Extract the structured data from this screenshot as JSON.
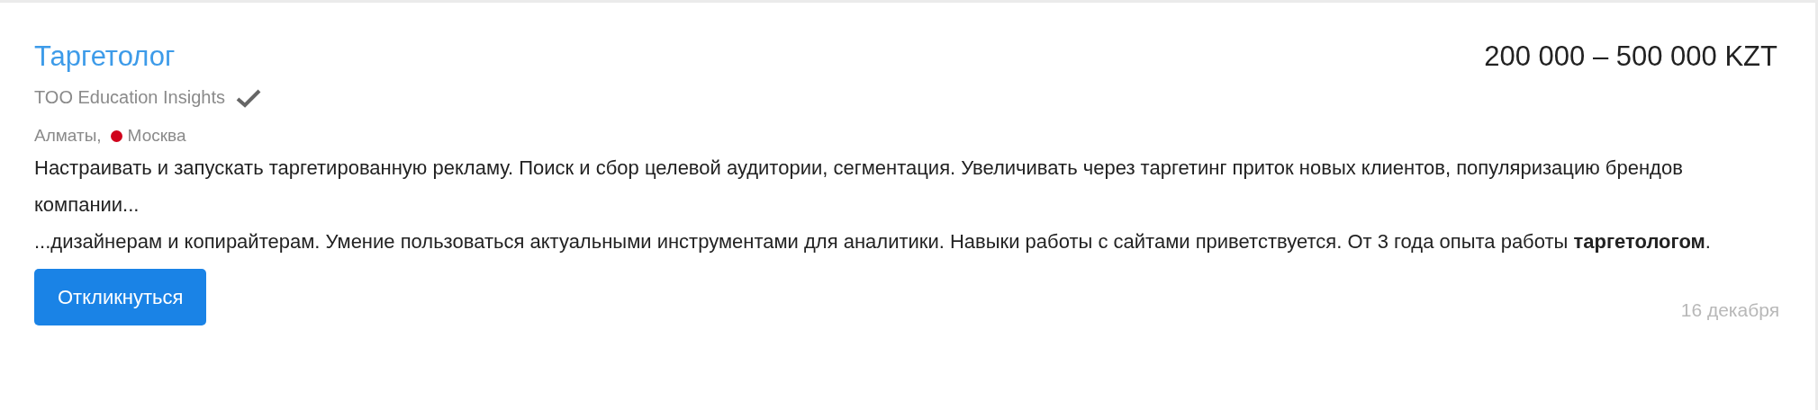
{
  "vacancy": {
    "title": "Таргетолог",
    "salary": "200 000 – 500 000 KZT",
    "company": {
      "name": "TOO Education Insights",
      "verified": true
    },
    "locations": [
      {
        "name": "Алматы,"
      },
      {
        "name": "Москва",
        "color": "#d0021b"
      }
    ],
    "snippets": [
      "Настраивать и запускать таргетированную рекламу. Поиск и сбор целевой аудитории, сегментация. Увеличивать через таргетинг приток новых клиентов, популяризацию брендов компании...",
      "...дизайнерам и копирайтерам. Умение пользоваться актуальными инструментами для аналитики. Навыки работы с сайтами приветствуется. От 3 года опыта работы **таргетологом**."
    ],
    "respond_button": "Откликнуться",
    "date": "16 декабря"
  }
}
